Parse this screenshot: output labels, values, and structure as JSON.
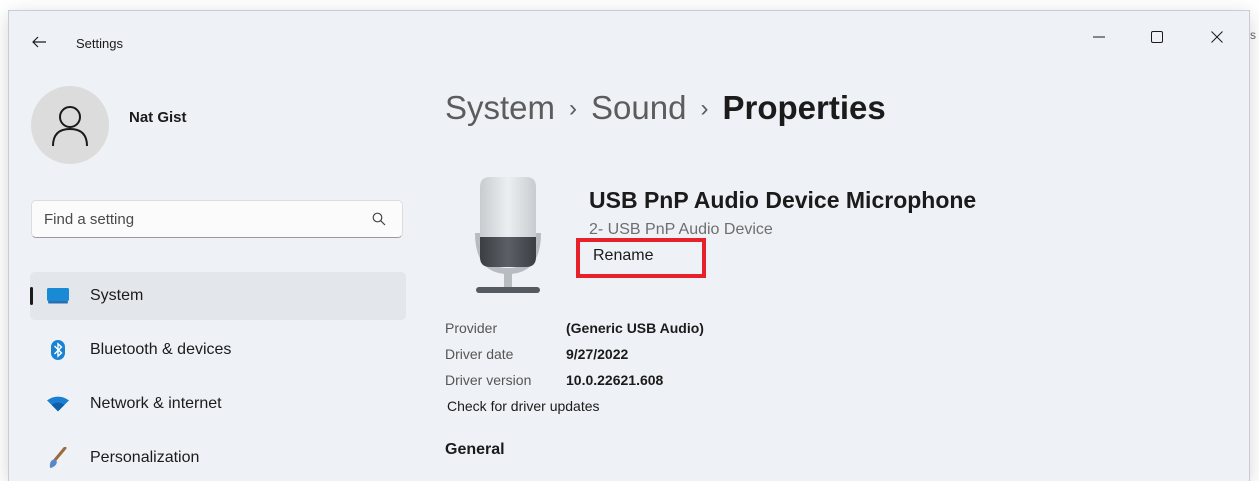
{
  "window": {
    "app_title": "Settings",
    "edge_fragment": "s"
  },
  "user": {
    "name": "Nat Gist"
  },
  "search": {
    "placeholder": "Find a setting",
    "value": ""
  },
  "sidebar": {
    "items": [
      {
        "label": "System",
        "icon": "system-icon",
        "active": true
      },
      {
        "label": "Bluetooth & devices",
        "icon": "bluetooth-icon",
        "active": false
      },
      {
        "label": "Network & internet",
        "icon": "wifi-icon",
        "active": false
      },
      {
        "label": "Personalization",
        "icon": "brush-icon",
        "active": false
      }
    ]
  },
  "breadcrumb": {
    "items": [
      "System",
      "Sound"
    ],
    "separator": "›",
    "current": "Properties"
  },
  "device": {
    "name": "USB PnP Audio Device Microphone",
    "subtitle": "2- USB PnP Audio Device",
    "rename_label": "Rename"
  },
  "properties": [
    {
      "label": "Provider",
      "value": "(Generic USB Audio)"
    },
    {
      "label": "Driver date",
      "value": "9/27/2022"
    },
    {
      "label": "Driver version",
      "value": "10.0.22621.608"
    }
  ],
  "driver_update_link": "Check for driver updates",
  "sections": {
    "general": "General"
  },
  "colors": {
    "window_bg": "#eef2f6",
    "highlight": "#e8202a",
    "accent": "#0067c0",
    "active_nav_bg": "#e3e7ec"
  }
}
